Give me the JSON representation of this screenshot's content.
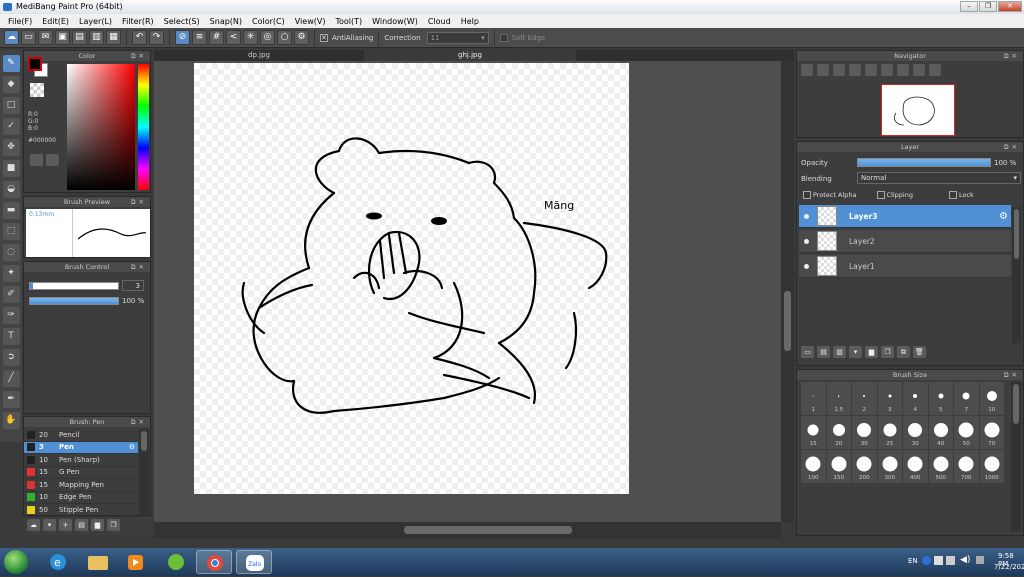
{
  "app": {
    "title": "MediBang Paint Pro (64bit)"
  },
  "menu": [
    "File(F)",
    "Edit(E)",
    "Layer(L)",
    "Filter(R)",
    "Select(S)",
    "Snap(N)",
    "Color(C)",
    "View(V)",
    "Tool(T)",
    "Window(W)",
    "Cloud",
    "Help"
  ],
  "toolbar": {
    "antialiasing_label": "AntiAliasing",
    "correction_label": "Correction",
    "correction_value": "11",
    "soft_edge_label": "Soft Edge"
  },
  "color_panel": {
    "title": "Color",
    "r": "R:0",
    "g": "G:0",
    "b": "B:0",
    "hex": "#000000",
    "accent": "#4f91d4"
  },
  "brush_preview": {
    "title": "Brush Preview",
    "size": "0.13mm"
  },
  "brush_control": {
    "title": "Brush Control",
    "size_value": "3",
    "opacity_value": "100 %"
  },
  "brush_panel": {
    "title": "Brush: Pen",
    "items": [
      {
        "num": "20",
        "name": "Pencil",
        "color": "#222222"
      },
      {
        "num": "3",
        "name": "Pen",
        "color": "#222222"
      },
      {
        "num": "10",
        "name": "Pen (Sharp)",
        "color": "#222222"
      },
      {
        "num": "15",
        "name": "G Pen",
        "color": "#e03030"
      },
      {
        "num": "15",
        "name": "Mapping Pen",
        "color": "#e03030"
      },
      {
        "num": "10",
        "name": "Edge Pen",
        "color": "#30b030"
      },
      {
        "num": "50",
        "name": "Stipple Pen",
        "color": "#e8d020"
      }
    ]
  },
  "tabs": [
    "dp.jpg",
    "ghj.jpg"
  ],
  "canvas": {
    "signature": "Măng"
  },
  "navigator": {
    "title": "Navigator"
  },
  "layer_panel": {
    "title": "Layer",
    "opacity_label": "Opacity",
    "opacity_value": "100 %",
    "blending_label": "Blending",
    "blending_value": "Normal",
    "protect_alpha": "Protect Alpha",
    "clipping": "Clipping",
    "lock": "Lock",
    "layers": [
      "Layer3",
      "Layer2",
      "Layer1"
    ]
  },
  "brush_size": {
    "title": "Brush Size",
    "sizes": [
      "1",
      "1.5",
      "2",
      "3",
      "4",
      "5",
      "7",
      "10",
      "15",
      "20",
      "30",
      "25",
      "30",
      "40",
      "50",
      "70",
      "100",
      "150",
      "200",
      "300",
      "400",
      "500",
      "700",
      "1000"
    ]
  },
  "taskbar": {
    "lang": "EN",
    "time": "9:58 PM",
    "date": "7/22/2020",
    "zalo": "Zalo"
  }
}
